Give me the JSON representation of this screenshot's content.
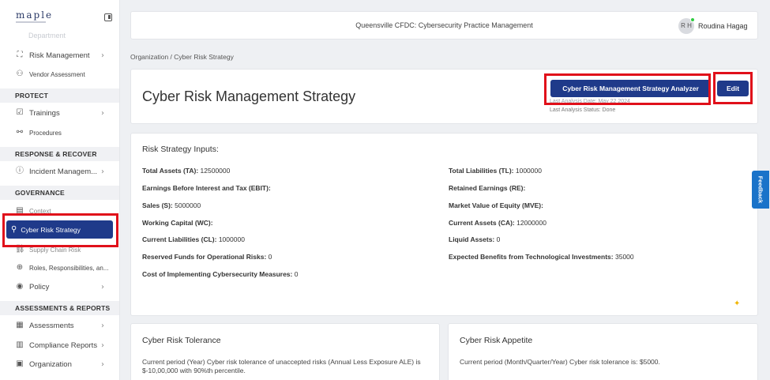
{
  "app": {
    "logo": "maple",
    "org_name": "Queensville CFDC: Cybersecurity Practice Management",
    "user_initials": "R H",
    "user_name": "Roudina Hagag"
  },
  "sidebar": {
    "ghost_item": "Department",
    "items": [
      {
        "label": "Risk Management",
        "icon": "risk-icon",
        "chevron": true
      },
      {
        "label": "Vendor Assessment",
        "icon": "vendor-icon",
        "chevron": false
      }
    ],
    "sections": {
      "protect": "PROTECT",
      "response": "RESPONSE & RECOVER",
      "governance": "GOVERNANCE",
      "assessments": "ASSESSMENTS & REPORTS"
    },
    "protect_items": [
      {
        "label": "Trainings",
        "chevron": true
      },
      {
        "label": "Procedures",
        "chevron": false
      }
    ],
    "response_items": [
      {
        "label": "Incident Managem...",
        "chevron": true
      }
    ],
    "governance_items": {
      "context": "Context",
      "active": "Cyber Risk Strategy",
      "supply": "Supply Chain Risk",
      "roles": "Roles, Responsibilities, an...",
      "policy": "Policy"
    },
    "assessment_items": [
      {
        "label": "Assessments",
        "chevron": true
      },
      {
        "label": "Compliance Reports",
        "chevron": true
      },
      {
        "label": "Organization",
        "chevron": true
      }
    ]
  },
  "breadcrumb": "Organization  /  Cyber Risk Strategy",
  "header": {
    "title": "Cyber Risk Management Strategy",
    "analyzer_button": "Cyber Risk Management Strategy Analyzer",
    "edit_button": "Edit",
    "last_analysis_date": "Last Analysis Date: May 22 2024",
    "last_analysis_status": "Last Analysis Status: Done"
  },
  "inputs": {
    "title": "Risk Strategy Inputs:",
    "left": [
      {
        "label": "Total Assets (TA):",
        "value": "12500000"
      },
      {
        "label": "Earnings Before Interest and Tax (EBIT):",
        "value": ""
      },
      {
        "label": "Sales (S):",
        "value": "5000000"
      },
      {
        "label": "Working Capital (WC):",
        "value": ""
      },
      {
        "label": "Current Liabilities (CL):",
        "value": "1000000"
      },
      {
        "label": "Reserved Funds for Operational Risks:",
        "value": "0"
      },
      {
        "label": "Cost of Implementing Cybersecurity Measures:",
        "value": "0"
      }
    ],
    "right": [
      {
        "label": "Total Liabilities (TL):",
        "value": "1000000"
      },
      {
        "label": "Retained Earnings (RE):",
        "value": ""
      },
      {
        "label": "Market Value of Equity (MVE):",
        "value": ""
      },
      {
        "label": "Current Assets (CA):",
        "value": "12000000"
      },
      {
        "label": "Liquid Assets:",
        "value": "0"
      },
      {
        "label": "Expected Benefits from Technological Investments:",
        "value": "35000"
      }
    ]
  },
  "tolerance": {
    "title": "Cyber Risk Tolerance",
    "text": "Current period (Year) Cyber risk tolerance of unaccepted risks (Annual Less Exposure ALE) is $-10,00,000 with 90%th percentile."
  },
  "appetite": {
    "title": "Cyber Risk Appetite",
    "text": "Current period (Month/Quarter/Year) Cyber risk tolerance is: $5000."
  },
  "feedback_label": "Feedback",
  "colors": {
    "primary": "#1f3a8a",
    "highlight": "#e0101a",
    "feedback": "#1a73c9"
  }
}
